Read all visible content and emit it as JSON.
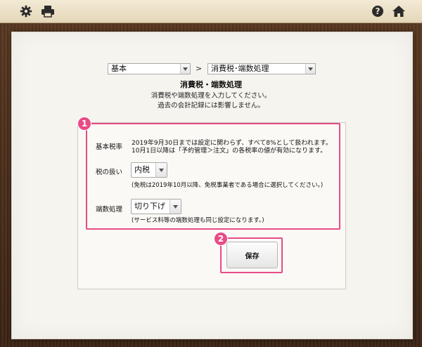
{
  "toolbar": {
    "icons": [
      "gear-icon",
      "printer-icon",
      "help-icon",
      "home-icon"
    ]
  },
  "breadcrumb": {
    "level1": "基本",
    "separator": ">",
    "level2": "消費税･端数処理"
  },
  "header": {
    "title": "消費税・端数処理",
    "desc_line1": "消費税や端数処理を入力してください。",
    "desc_line2": "過去の会計記録には影響しません。"
  },
  "annotations": {
    "badge1": "1",
    "badge2": "2"
  },
  "form": {
    "base_rate": {
      "label": "基本税率",
      "text_line1": "2019年9月30日までは設定に関わらず、すべて8%として扱われます。",
      "text_line2": "10月1日以降は「予約管理＞注文」の各税率の値が有効になります。"
    },
    "tax_handling": {
      "label": "税の扱い",
      "value": "内税",
      "note": "(免税は2019年10月以降、免税事業者である場合に選択してください。)"
    },
    "rounding": {
      "label": "端数処理",
      "value": "切り下げ",
      "note": "(サービス料等の端数処理も同じ設定になります。)"
    }
  },
  "actions": {
    "save_label": "保存"
  },
  "colors": {
    "accent": "#e84b86",
    "frame": "#4a2e1c",
    "topbar": "#efe4cb"
  }
}
